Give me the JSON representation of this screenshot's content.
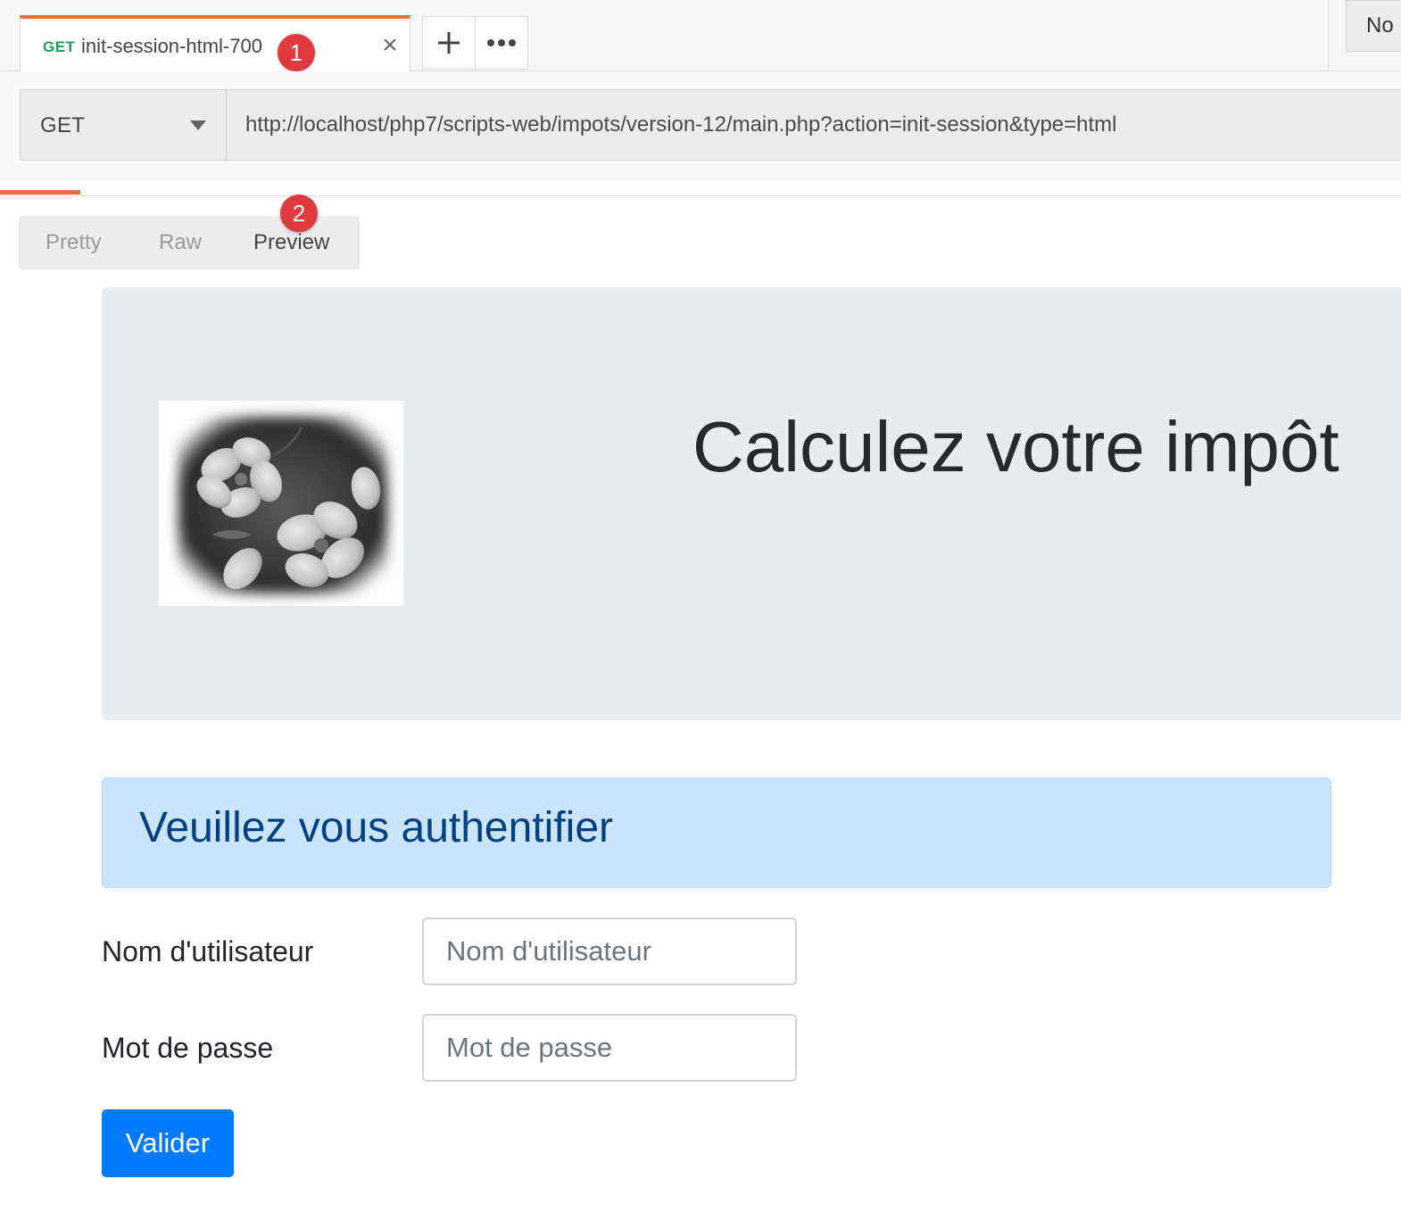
{
  "tabs": {
    "active": {
      "method": "GET",
      "name": "init-session-html-700",
      "close_glyph": "×"
    },
    "new_tab_glyph": "+",
    "more_glyph": "•••",
    "right_button_label": "No"
  },
  "request": {
    "method": "GET",
    "url": "http://localhost/php7/scripts-web/impots/version-12/main.php?action=init-session&type=html"
  },
  "response_view": {
    "modes": [
      "Pretty",
      "Raw",
      "Preview"
    ],
    "selected": "Preview"
  },
  "annotations": {
    "badge_1": "1",
    "badge_2": "2"
  },
  "preview": {
    "jumbotron": {
      "title": "Calculez votre impôt",
      "image_alt": "flower-photo"
    },
    "alert": {
      "text": "Veuillez vous authentifier"
    },
    "form": {
      "username_label": "Nom d'utilisateur",
      "username_placeholder": "Nom d'utilisateur",
      "username_value": "",
      "password_label": "Mot de passe",
      "password_placeholder": "Mot de passe",
      "password_value": "",
      "submit_label": "Valider"
    }
  },
  "colors": {
    "accent_orange": "#f26b3a",
    "method_get_green": "#1d9a55",
    "badge_red": "#e03a3e",
    "jumbotron_bg": "#e8ebef",
    "alert_bg": "#cce5ff",
    "alert_text": "#004085",
    "primary_button": "#007bff"
  },
  "icons": {
    "tab_close": "close-icon",
    "new_tab": "plus-icon",
    "more": "more-horizontal-icon",
    "method_dropdown": "chevron-down-icon"
  }
}
